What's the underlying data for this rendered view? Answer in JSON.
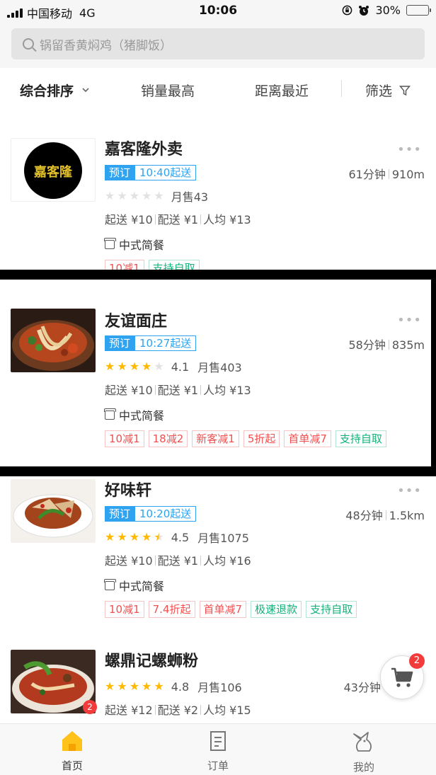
{
  "status_bar": {
    "carrier": "中国移动",
    "network": "4G",
    "time": "10:06",
    "battery": "30%",
    "battery_level": 0.3
  },
  "search": {
    "placeholder": "锅留香黄焖鸡（猪脚饭）"
  },
  "sort_bar": {
    "items": [
      "综合排序",
      "销量最高",
      "距离最近",
      "筛选"
    ]
  },
  "shops": [
    {
      "name": "嘉客隆外卖",
      "logo_text": "嘉客隆",
      "preorder": "预订",
      "delivery_time": "10:40起送",
      "eta": "61分钟",
      "distance": "910m",
      "stars": 0,
      "rating": "",
      "monthly_sales": "月售43",
      "min_order": "起送 ¥10",
      "delivery_fee": "配送 ¥1",
      "per_person": "人均 ¥13",
      "category": "中式简餐",
      "promos": [
        "10减1",
        "支持自取"
      ]
    },
    {
      "name": "友谊面庄",
      "preorder": "预订",
      "delivery_time": "10:27起送",
      "eta": "58分钟",
      "distance": "835m",
      "stars": 4,
      "rating": "4.1",
      "monthly_sales": "月售403",
      "min_order": "起送 ¥10",
      "delivery_fee": "配送 ¥1",
      "per_person": "人均 ¥13",
      "category": "中式简餐",
      "promos": [
        "10减1",
        "18减2",
        "新客减1",
        "5折起",
        "首单减7",
        "支持自取"
      ]
    },
    {
      "name": "好味轩",
      "preorder": "预订",
      "delivery_time": "10:20起送",
      "eta": "48分钟",
      "distance": "1.5km",
      "stars": 4.5,
      "rating": "4.5",
      "monthly_sales": "月售1075",
      "min_order": "起送 ¥10",
      "delivery_fee": "配送 ¥1",
      "per_person": "人均 ¥16",
      "category": "中式简餐",
      "promos": [
        "10减1",
        "7.4折起",
        "首单减7",
        "极速退款",
        "支持自取"
      ]
    },
    {
      "name": "螺鼎记螺蛳粉",
      "stars": 5,
      "rating": "4.8",
      "monthly_sales": "月售106",
      "eta": "43分钟",
      "min_order": "起送 ¥12",
      "delivery_fee": "配送 ¥2",
      "per_person": "人均 ¥15",
      "thumb_badge": "2"
    }
  ],
  "cart": {
    "badge": "2"
  },
  "tab_bar": {
    "items": [
      "首页",
      "订单",
      "我的"
    ]
  },
  "colors": {
    "accent_blue": "#2fa2f0",
    "promo_red": "#f05050",
    "promo_green": "#13b37a",
    "star": "#ffb900",
    "badge_red": "#f23c3c"
  }
}
